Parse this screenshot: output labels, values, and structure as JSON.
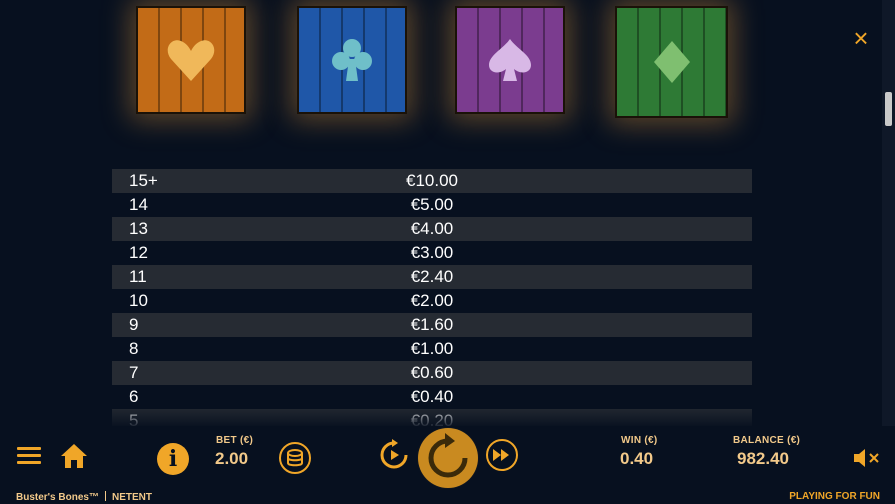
{
  "symbols": [
    {
      "name": "heart",
      "color": "#c26b17"
    },
    {
      "name": "club",
      "color": "#1f57a8"
    },
    {
      "name": "spade",
      "color": "#7b3c8f"
    },
    {
      "name": "diamond",
      "color": "#2e7a35"
    }
  ],
  "close_icon": "×",
  "paytable": [
    {
      "count": "15+",
      "prize": "€10.00"
    },
    {
      "count": "14",
      "prize": "€5.00"
    },
    {
      "count": "13",
      "prize": "€4.00"
    },
    {
      "count": "12",
      "prize": "€3.00"
    },
    {
      "count": "11",
      "prize": "€2.40"
    },
    {
      "count": "10",
      "prize": "€2.00"
    },
    {
      "count": "9",
      "prize": "€1.60"
    },
    {
      "count": "8",
      "prize": "€1.00"
    },
    {
      "count": "7",
      "prize": "€0.60"
    },
    {
      "count": "6",
      "prize": "€0.40"
    },
    {
      "count": "5",
      "prize": "€0.20"
    }
  ],
  "bottom_bar": {
    "bet_label": "BET (€)",
    "bet_value": "2.00",
    "win_label": "WIN (€)",
    "win_value": "0.40",
    "balance_label": "BALANCE (€)",
    "balance_value": "982.40"
  },
  "footer": {
    "game_title": "Buster's Bones™",
    "provider": "NETENT",
    "mode": "PLAYING FOR FUN"
  },
  "colors": {
    "accent": "#f0a628",
    "background": "#07101f",
    "row_stripe": "#262b33"
  }
}
